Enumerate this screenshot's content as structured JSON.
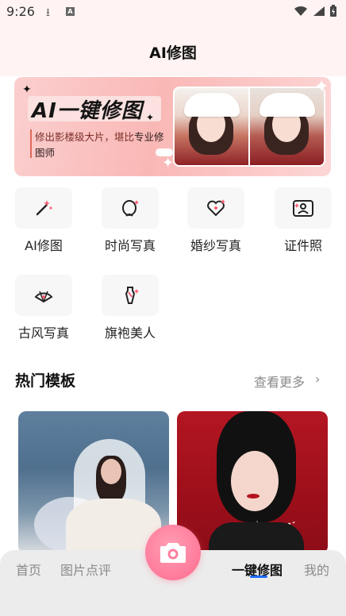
{
  "status_bar": {
    "time": "9:26",
    "download_glyph": "⭳",
    "notification_letter": "A"
  },
  "header": {
    "title": "AI修图"
  },
  "banner": {
    "headline": "AI一键修图",
    "subtitle_part1": "修出影楼级大片，堪比",
    "subtitle_part2": "专业修图师"
  },
  "features": [
    {
      "label": "AI修图",
      "icon": "magic-wand-icon"
    },
    {
      "label": "时尚写真",
      "icon": "face-sparkle-icon"
    },
    {
      "label": "婚纱写真",
      "icon": "heart-sparkle-icon"
    },
    {
      "label": "证件照",
      "icon": "id-photo-icon"
    },
    {
      "label": "古风写真",
      "icon": "folding-fan-icon"
    },
    {
      "label": "旗袍美人",
      "icon": "qipao-icon"
    }
  ],
  "section": {
    "title": "热门模板",
    "more": "查看更多",
    "chevron": "›"
  },
  "tabbar": {
    "items": [
      "首页",
      "图片点评",
      "一键修图",
      "我的"
    ],
    "active_index": 2
  },
  "colors": {
    "accent_pink": "#ff7f9e",
    "active_underline": "#1f6bff",
    "header_bg": "#fff4f3"
  }
}
